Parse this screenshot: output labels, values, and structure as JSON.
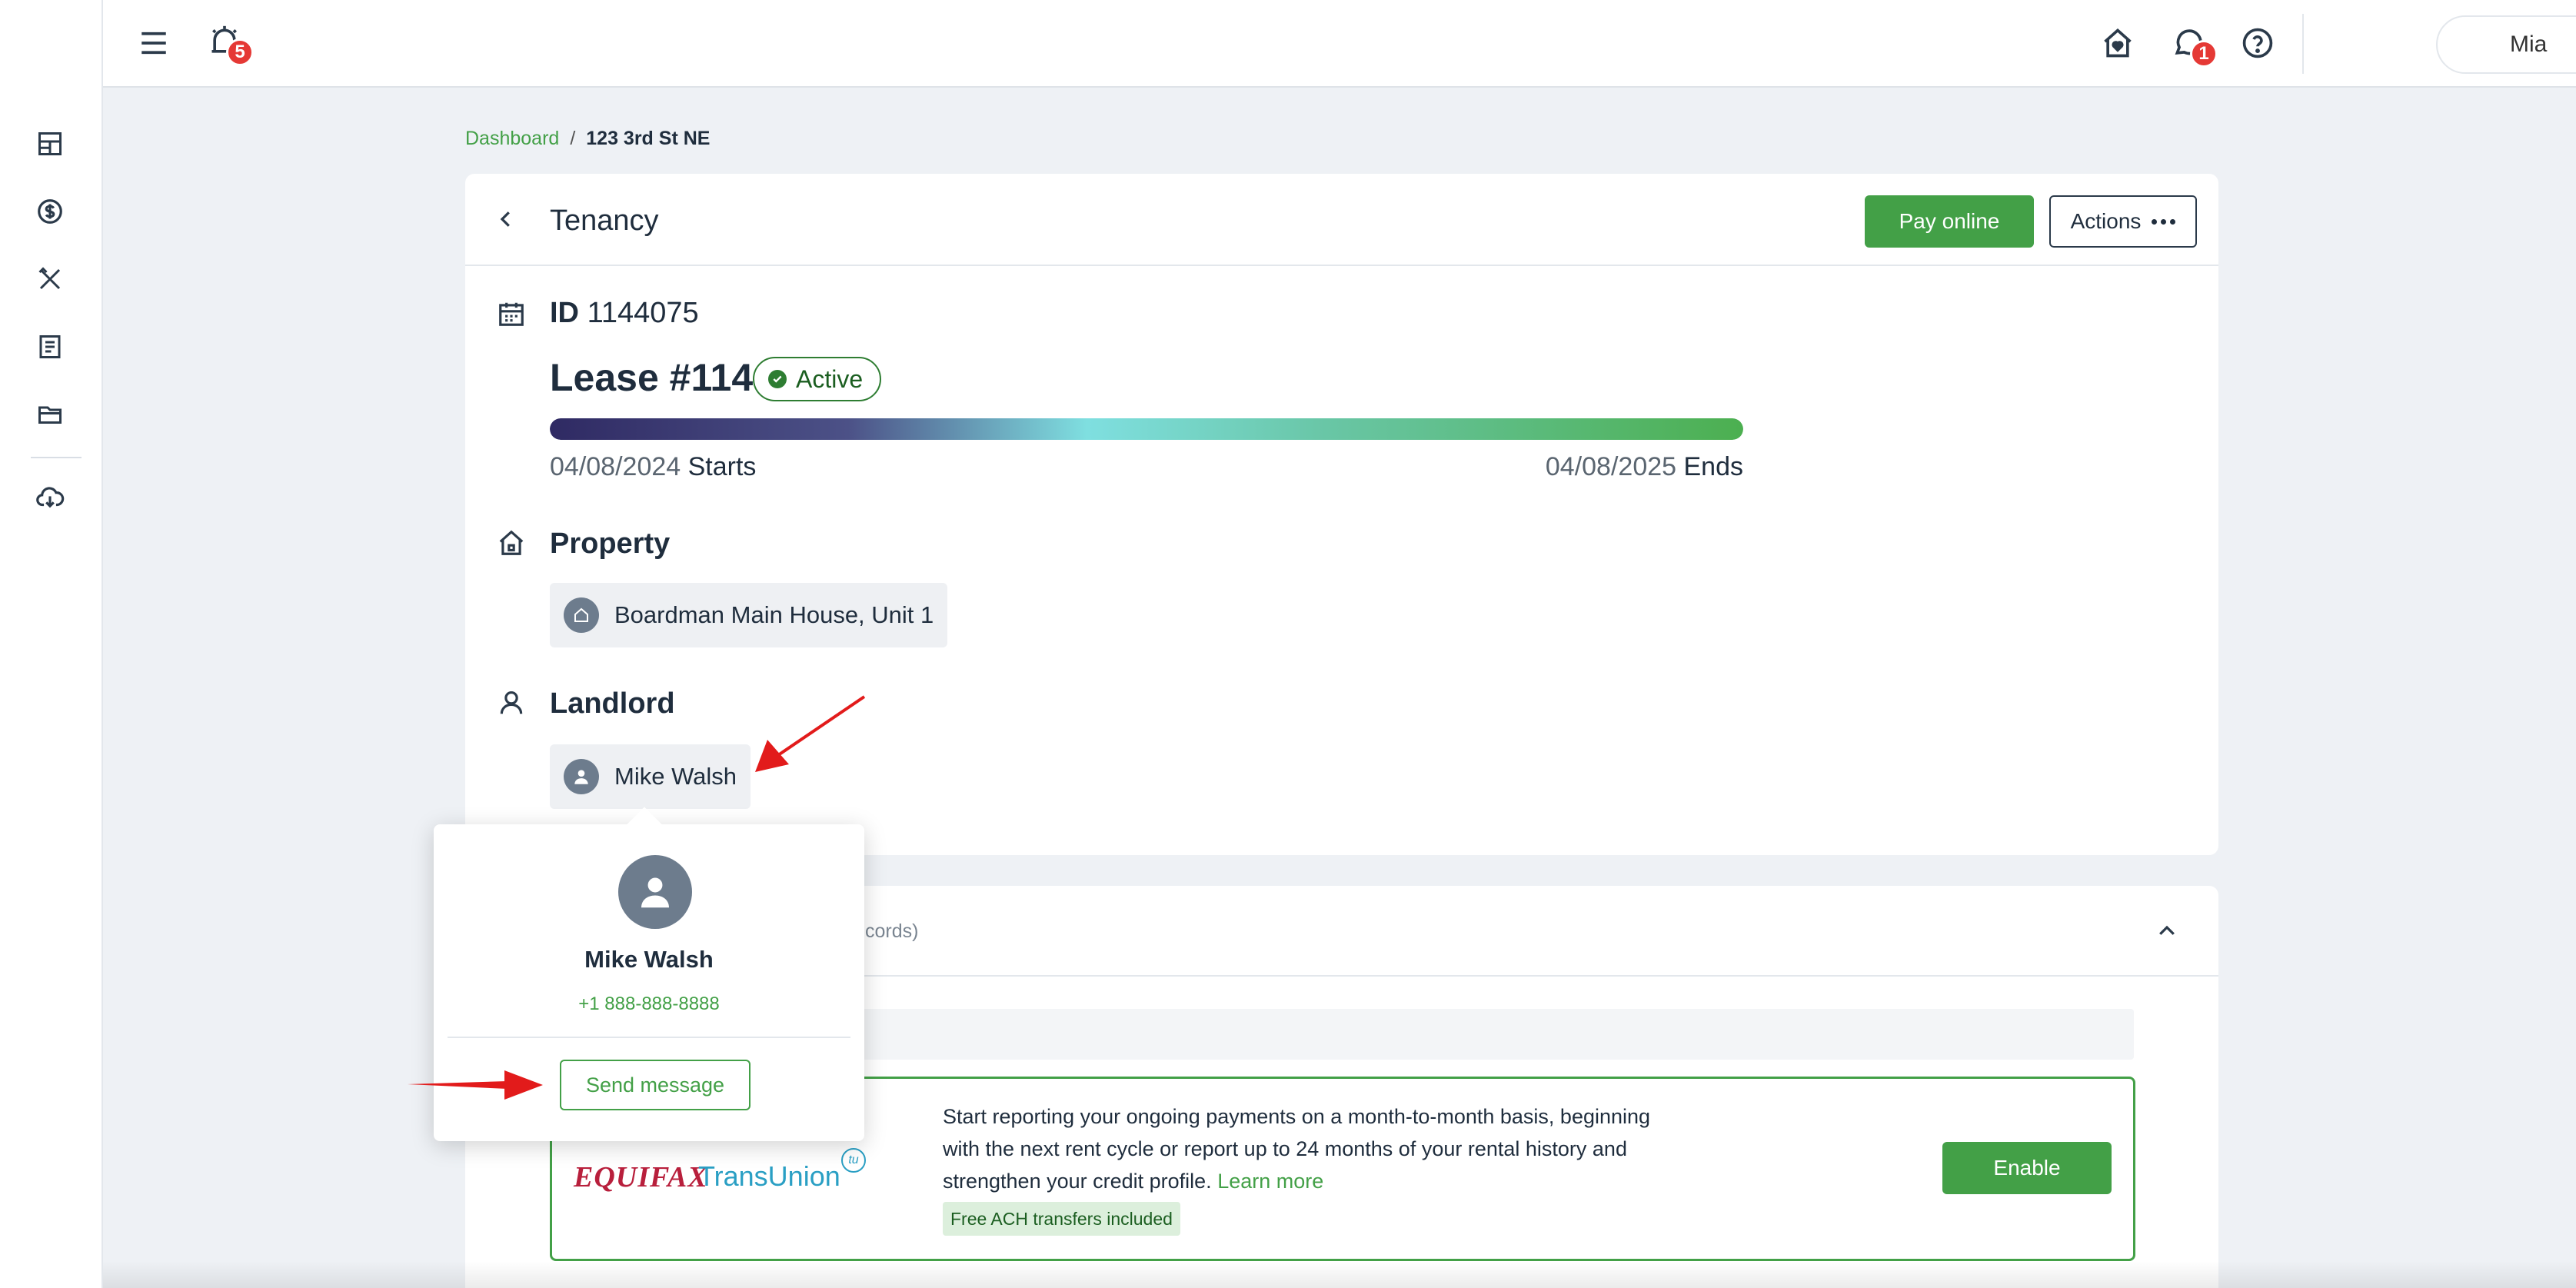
{
  "colors": {
    "accent_green": "#43a047",
    "badge_red": "#e53935",
    "status_green": "#2e7d32",
    "equifax_red": "#b81f3c",
    "transunion_blue": "#2a9fc4",
    "annotation_arrow_red": "#e21b1b"
  },
  "sidebar": {
    "items": [
      {
        "icon": "dashboard-grid-icon"
      },
      {
        "icon": "payments-dollar-icon"
      },
      {
        "icon": "maintenance-tools-icon"
      },
      {
        "icon": "document-icon"
      },
      {
        "icon": "folder-icon"
      },
      {
        "icon": "cloud-download-icon"
      }
    ]
  },
  "topbar": {
    "menu_icon": "hamburger-menu-icon",
    "notifications_icon": "alarm-bell-icon",
    "notifications_count": "5",
    "home_icon": "home-heart-icon",
    "messages_icon": "chat-bubble-icon",
    "messages_count": "1",
    "help_icon": "help-question-icon",
    "user_name": "Mia"
  },
  "breadcrumb": {
    "link": "Dashboard",
    "separator": "/",
    "current": "123 3rd St NE"
  },
  "tenancy": {
    "title": "Tenancy",
    "pay_online_label": "Pay online",
    "actions_label": "Actions",
    "id_label": "ID",
    "id_value": "1144075",
    "lease_title": "Lease #114",
    "status": "Active",
    "lease_progress": 1.0,
    "start_date": "04/08/2024",
    "start_word": "Starts",
    "end_date": "04/08/2025",
    "end_word": "Ends",
    "property_heading": "Property",
    "property_name": "Boardman Main House, Unit 1",
    "landlord_heading": "Landlord",
    "landlord_name": "Mike Walsh"
  },
  "records_card": {
    "records_text": "cords)"
  },
  "credit_reporting": {
    "equifax_logo": "EQUIFAX",
    "transunion_logo": "TransUnion",
    "tu_mark": "tu",
    "text": "Start reporting your ongoing payments on a month-to-month basis, beginning with the next rent cycle or report up to 24 months of your rental history and strengthen your credit profile.",
    "learn_more": "Learn more",
    "ach_badge": "Free ACH transfers included",
    "enable_label": "Enable"
  },
  "landlord_popover": {
    "name": "Mike Walsh",
    "phone": "+1 888-888-8888",
    "send_message_label": "Send message"
  }
}
